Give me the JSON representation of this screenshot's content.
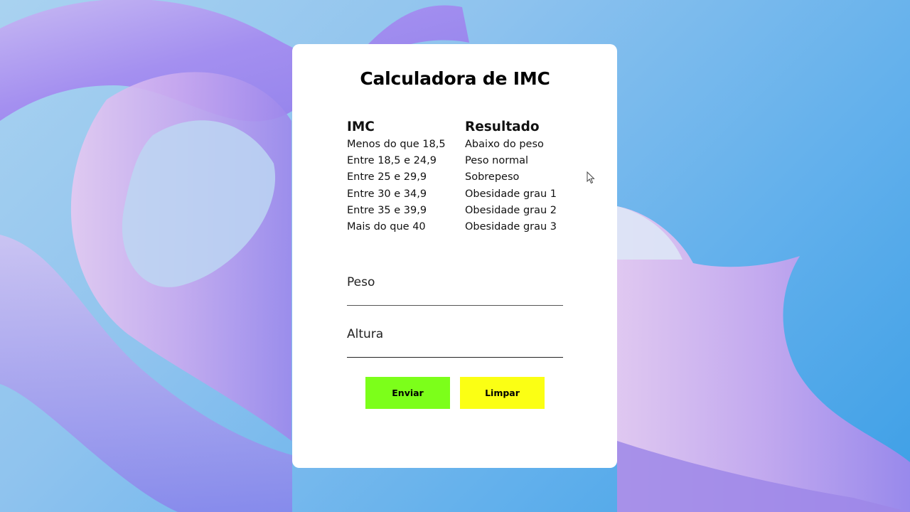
{
  "colors": {
    "card": "#ffffff",
    "send_button": "#7cff1a",
    "clear_button": "#fbff14"
  },
  "title": "Calculadora de IMC",
  "table": {
    "headers": [
      "IMC",
      "Resultado"
    ],
    "rows": [
      [
        "Menos do que 18,5",
        "Abaixo do peso"
      ],
      [
        "Entre 18,5 e 24,9",
        "Peso normal"
      ],
      [
        "Entre 25 e 29,9",
        "Sobrepeso"
      ],
      [
        "Entre 30 e 34,9",
        "Obesidade grau 1"
      ],
      [
        "Entre 35 e 39,9",
        "Obesidade grau 2"
      ],
      [
        "Mais do que 40",
        "Obesidade grau 3"
      ]
    ]
  },
  "form": {
    "weight_placeholder": "Peso",
    "weight_value": "",
    "height_placeholder": "Altura",
    "height_value": "",
    "send_label": "Enviar",
    "clear_label": "Limpar"
  },
  "icons": {
    "cursor": "mouse-pointer-icon"
  }
}
